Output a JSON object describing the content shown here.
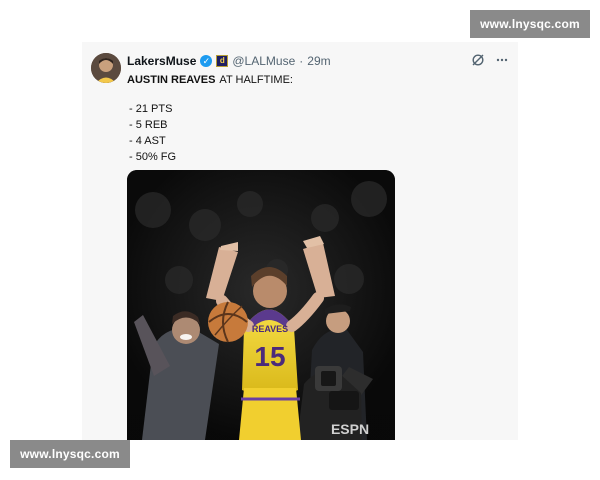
{
  "watermarks": {
    "top": "www.lnysqc.com",
    "bottom": "www.lnysqc.com"
  },
  "tweet": {
    "author_name": "LakersMuse",
    "handle": "@LALMuse",
    "separator": "·",
    "time": "29m",
    "affiliation_badge": "d",
    "title_strong": "AUSTIN REAVES",
    "title_rest": "AT HALFTIME:",
    "stats": [
      "- 21 PTS",
      "- 5 REB",
      "- 4 AST",
      "- 50% FG"
    ]
  },
  "photo": {
    "jersey_name": "REAVES",
    "jersey_number": "15",
    "camera_brand": "ESPN"
  },
  "icons": {
    "verified": "verified-check-icon",
    "affiliation": "affiliation-badge-icon",
    "grok": "grok-icon",
    "more": "more-icon"
  },
  "colors": {
    "verified": "#1d9bf0",
    "jersey": "#f4d22f",
    "jersey_text": "#4b2a7b",
    "watermark_bg": "#8a8a8a"
  }
}
